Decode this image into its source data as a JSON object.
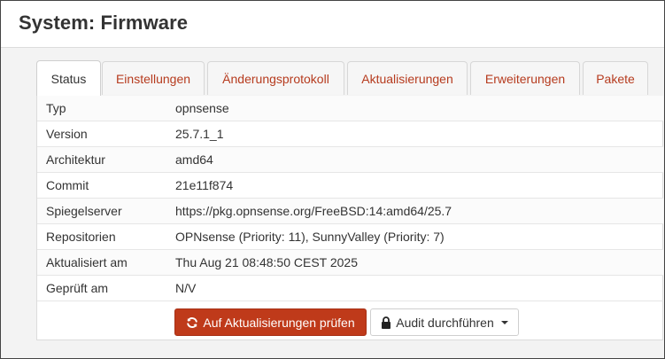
{
  "page": {
    "title": "System: Firmware"
  },
  "tabs": [
    {
      "label": "Status",
      "active": true
    },
    {
      "label": "Einstellungen",
      "active": false
    },
    {
      "label": "Änderungsprotokoll",
      "active": false
    },
    {
      "label": "Aktualisierungen",
      "active": false
    },
    {
      "label": "Erweiterungen",
      "active": false
    },
    {
      "label": "Pakete",
      "active": false
    }
  ],
  "status_rows": [
    {
      "label": "Typ",
      "value": "opnsense"
    },
    {
      "label": "Version",
      "value": "25.7.1_1"
    },
    {
      "label": "Architektur",
      "value": "amd64"
    },
    {
      "label": "Commit",
      "value": "21e11f874"
    },
    {
      "label": "Spiegelserver",
      "value": "https://pkg.opnsense.org/FreeBSD:14:amd64/25.7"
    },
    {
      "label": "Repositorien",
      "value": "OPNsense (Priority: 11), SunnyValley (Priority: 7)"
    },
    {
      "label": "Aktualisiert am",
      "value": "Thu Aug 21 08:48:50 CEST 2025"
    },
    {
      "label": "Geprüft am",
      "value": "N/V"
    }
  ],
  "actions": {
    "check_updates_label": "Auf Aktualisierungen prüfen",
    "check_updates_icon": "refresh-icon",
    "audit_label": "Audit durchführen",
    "audit_icon": "lock-icon"
  },
  "colors": {
    "accent": "#bf3a1a",
    "tab_link": "#b63b1e"
  }
}
